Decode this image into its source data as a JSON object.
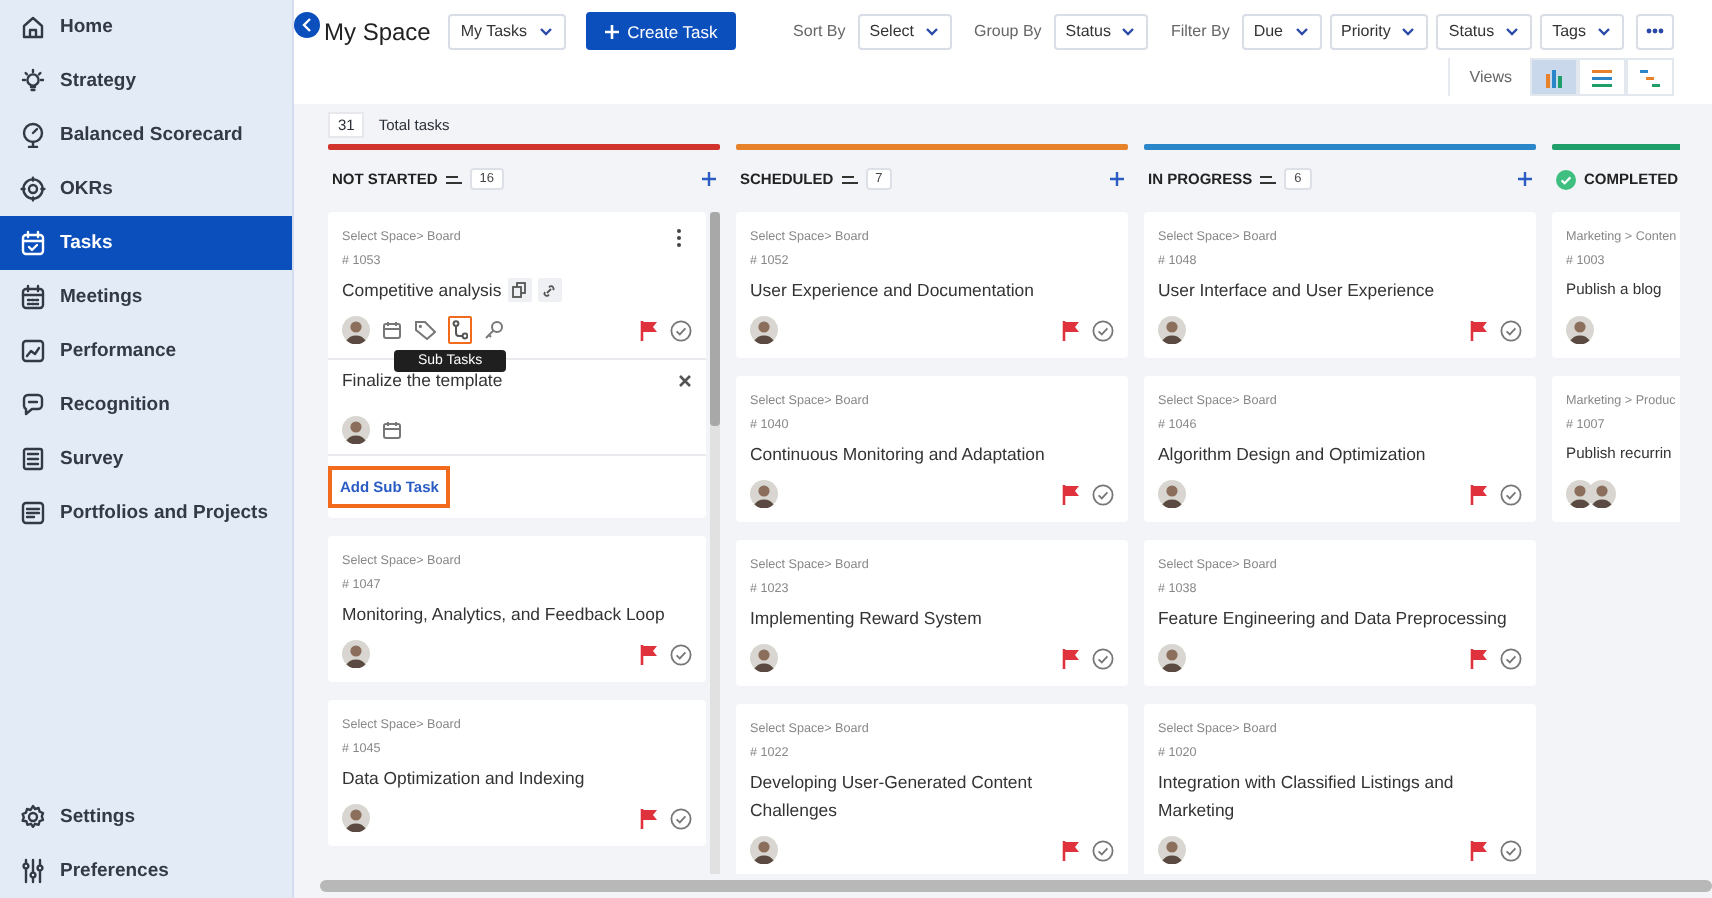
{
  "sidebar": {
    "items": [
      {
        "label": "Home",
        "selected": false
      },
      {
        "label": "Strategy",
        "selected": false
      },
      {
        "label": "Balanced Scorecard",
        "selected": false
      },
      {
        "label": "OKRs",
        "selected": false
      },
      {
        "label": "Tasks",
        "selected": true
      },
      {
        "label": "Meetings",
        "selected": false
      },
      {
        "label": "Performance",
        "selected": false
      },
      {
        "label": "Recognition",
        "selected": false
      },
      {
        "label": "Survey",
        "selected": false
      },
      {
        "label": "Portfolios and Projects",
        "selected": false
      }
    ],
    "bottom_items": [
      {
        "label": "Settings",
        "selected": false
      },
      {
        "label": "Preferences",
        "selected": false
      }
    ]
  },
  "header": {
    "title": "My Space",
    "scope": "My Tasks",
    "create_button": "Create Task",
    "sort": {
      "label": "Sort By",
      "value": "Select"
    },
    "group": {
      "label": "Group By",
      "value": "Status"
    },
    "filter": {
      "label": "Filter By",
      "options": [
        "Due",
        "Priority",
        "Status",
        "Tags"
      ]
    },
    "views": {
      "label": "Views",
      "items": [
        {
          "selected": true
        },
        {
          "selected": false
        },
        {
          "selected": false
        }
      ]
    }
  },
  "total": {
    "count": "31",
    "label": "Total tasks"
  },
  "columns": [
    {
      "title": "NOT STARTED",
      "kind": "open",
      "count": "16",
      "color": "#d0342c",
      "cards": [
        {
          "path": "Select Space> Board",
          "number": "# 1053",
          "title": "Competitive analysis",
          "expanded": true,
          "flagged": true,
          "avatars": [
            {
              "kind": "person"
            }
          ],
          "tooltip": "Sub Tasks",
          "subtask": {
            "value": "Finalize the template"
          },
          "add_label": "Add Sub Task"
        },
        {
          "path": "Select Space> Board",
          "number": "# 1047",
          "title": "Monitoring, Analytics, and Feedback Loop",
          "expanded": false,
          "flagged": true,
          "avatars": [
            {
              "kind": "person"
            }
          ]
        },
        {
          "path": "Select Space> Board",
          "number": "# 1045",
          "title": "Data Optimization and Indexing",
          "expanded": false,
          "flagged": true,
          "avatars": [
            {
              "kind": "person"
            }
          ]
        }
      ]
    },
    {
      "title": "SCHEDULED",
      "kind": "open",
      "count": "7",
      "color": "#e8822a",
      "cards": [
        {
          "path": "Select Space> Board",
          "number": "# 1052",
          "title": "User Experience and Documentation",
          "expanded": false,
          "flagged": true,
          "avatars": [
            {
              "kind": "person"
            }
          ]
        },
        {
          "path": "Select Space> Board",
          "number": "# 1040",
          "title": "Continuous Monitoring and Adaptation",
          "expanded": false,
          "flagged": true,
          "avatars": [
            {
              "kind": "person"
            }
          ]
        },
        {
          "path": "Select Space> Board",
          "number": "# 1023",
          "title": "Implementing Reward System",
          "expanded": false,
          "flagged": true,
          "avatars": [
            {
              "kind": "person"
            }
          ]
        },
        {
          "path": "Select Space> Board",
          "number": "# 1022",
          "title": "Developing User-Generated Content Challenges",
          "expanded": false,
          "flagged": true,
          "avatars": [
            {
              "kind": "person"
            }
          ]
        }
      ]
    },
    {
      "title": "IN PROGRESS",
      "kind": "open",
      "count": "6",
      "color": "#2a86c8",
      "cards": [
        {
          "path": "Select Space> Board",
          "number": "# 1048",
          "title": "User Interface and User Experience",
          "expanded": false,
          "flagged": true,
          "avatars": [
            {
              "kind": "person"
            }
          ]
        },
        {
          "path": "Select Space> Board",
          "number": "# 1046",
          "title": "Algorithm Design and Optimization",
          "expanded": false,
          "flagged": true,
          "avatars": [
            {
              "kind": "person"
            }
          ]
        },
        {
          "path": "Select Space> Board",
          "number": "# 1038",
          "title": "Feature Engineering and Data Preprocessing",
          "expanded": false,
          "flagged": true,
          "avatars": [
            {
              "kind": "person"
            }
          ]
        },
        {
          "path": "Select Space> Board",
          "number": "# 1020",
          "title": "Integration with Classified Listings and Marketing",
          "expanded": false,
          "flagged": true,
          "avatars": [
            {
              "kind": "person"
            }
          ]
        }
      ]
    },
    {
      "title": "COMPLETED",
      "kind": "done",
      "color": "#1f9e6a",
      "cards": [
        {
          "path": "Marketing > Conten",
          "number": "# 1003",
          "title": "Publish a blog",
          "expanded": false,
          "flagged": false,
          "avatars": [
            {
              "kind": "person"
            }
          ]
        },
        {
          "path": "Marketing > Produc",
          "number": "# 1007",
          "title": "Publish recurrin",
          "expanded": false,
          "flagged": false,
          "avatars": [
            {
              "kind": "person"
            },
            {
              "kind": "person"
            }
          ]
        }
      ]
    }
  ]
}
